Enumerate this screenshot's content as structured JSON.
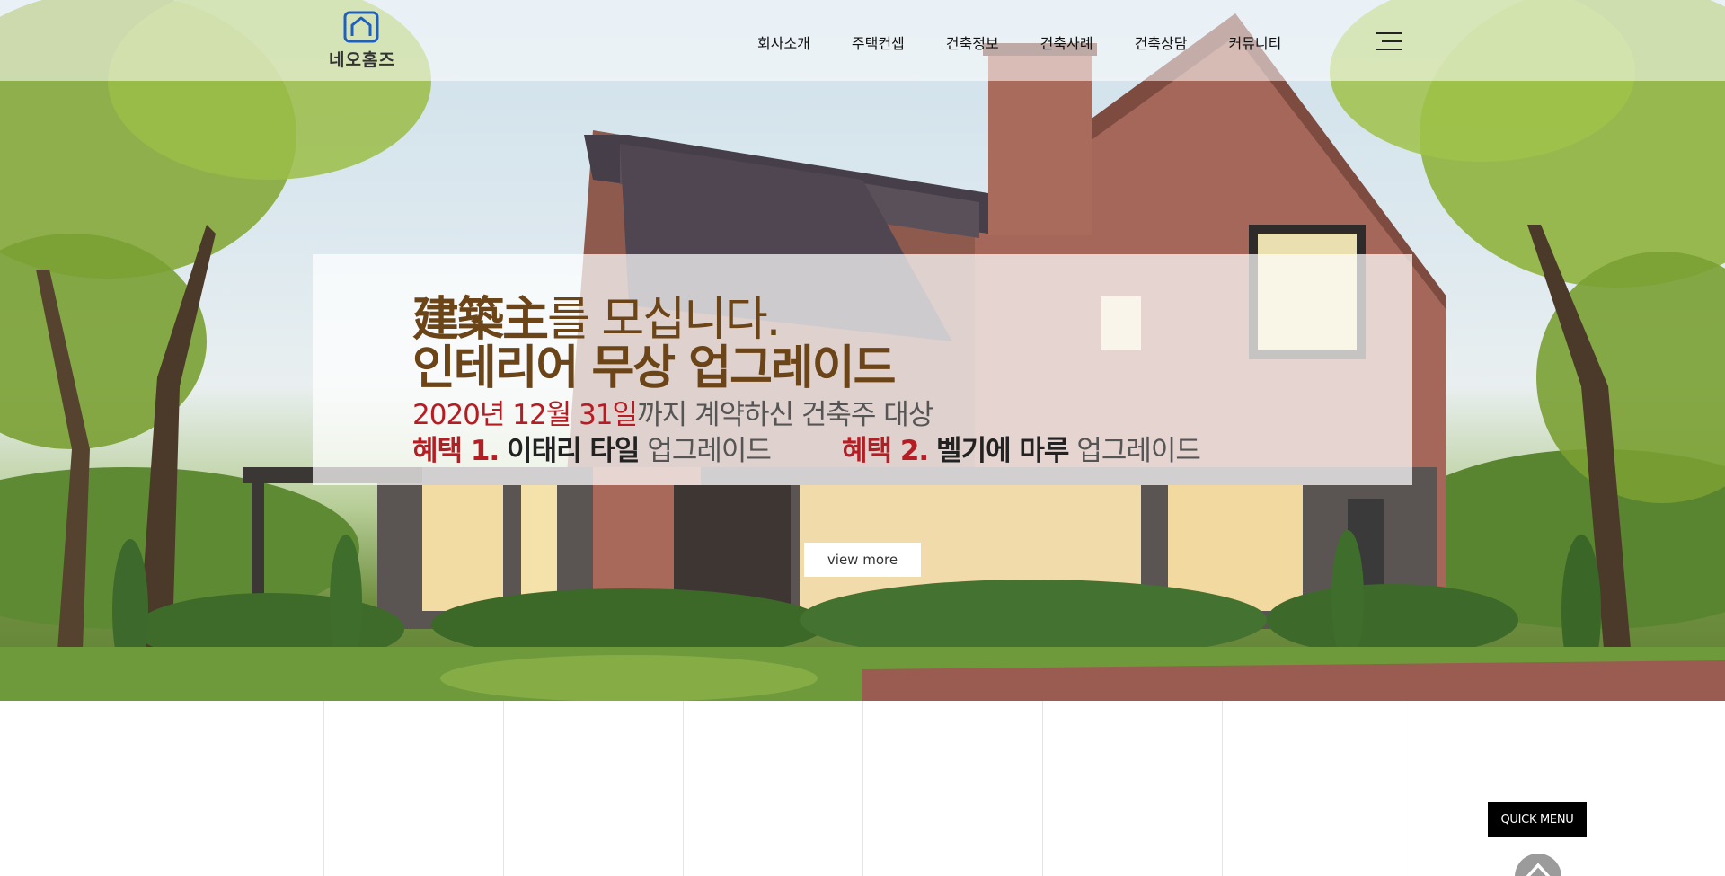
{
  "brand": {
    "name": "네오홈즈",
    "accent_color": "#1f5fbf",
    "icon": "house-icon"
  },
  "nav": {
    "items": [
      {
        "label": "회사소개"
      },
      {
        "label": "주택컨셉"
      },
      {
        "label": "건축정보"
      },
      {
        "label": "건축사례"
      },
      {
        "label": "건축상담"
      },
      {
        "label": "커뮤니티"
      }
    ],
    "menu_icon": "hamburger-menu-icon"
  },
  "promo": {
    "headline_kanji": "建築主",
    "headline_rest": "를 모십니다.",
    "headline2": "인테리어 무상 업그레이드",
    "date": "2020년 12월 31일",
    "date_suffix": "까지 계약하신 건축주 대상",
    "benefit1": {
      "tag": "혜택 1.",
      "item": "이태리 타일",
      "rest": "업그레이드"
    },
    "benefit2": {
      "tag": "혜택 2.",
      "item": "벨기에 마루",
      "rest": "업그레이드"
    },
    "headline_color": "#6b4417",
    "highlight_color": "#b31d23"
  },
  "hero": {
    "view_more": "view more"
  },
  "quick_menu": {
    "label": "QUICK MENU",
    "top_icon": "chevron-up-icon"
  }
}
